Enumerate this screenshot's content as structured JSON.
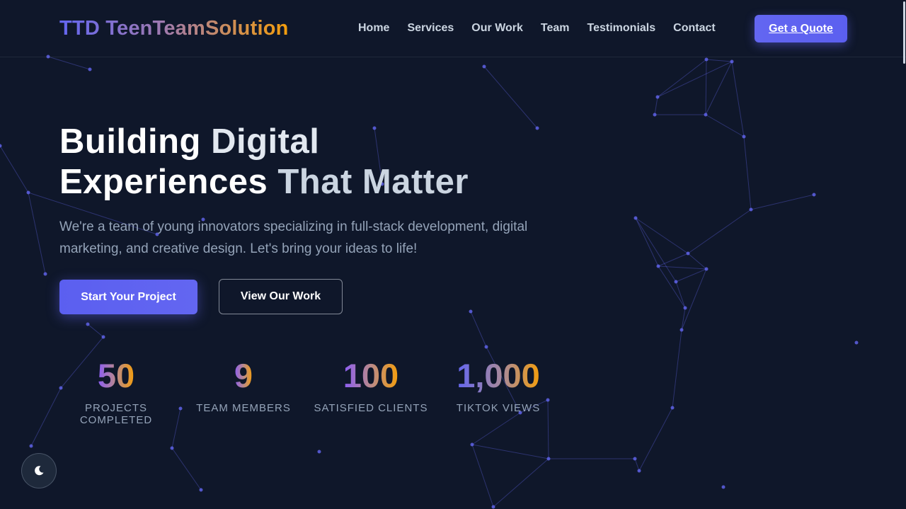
{
  "logo": "TTD TeenTeamSolution",
  "nav": {
    "items": [
      "Home",
      "Services",
      "Our Work",
      "Team",
      "Testimonials",
      "Contact"
    ],
    "cta": "Get a Quote"
  },
  "hero": {
    "title_line1_a": "Building",
    "title_line1_b": "Digital",
    "title_line2_a": "Experiences",
    "title_line2_b": "That Matter",
    "description": "We're a team of young innovators specializing in full-stack development, digital marketing, and creative design. Let's bring your ideas to life!",
    "primary_button": "Start Your Project",
    "secondary_button": "View Our Work"
  },
  "stats": [
    {
      "value": "50",
      "label": "Projects Completed"
    },
    {
      "value": "9",
      "label": "Team Members"
    },
    {
      "value": "100",
      "label": "Satisfied Clients"
    },
    {
      "value": "1,000",
      "label": "TikTok Views"
    }
  ],
  "theme_toggle": {
    "icon": "moon-icon"
  },
  "colors": {
    "background": "#0f172a",
    "accent": "#6366f1",
    "accent_warm": "#f59e0b",
    "muted_text": "#94a3b8"
  }
}
